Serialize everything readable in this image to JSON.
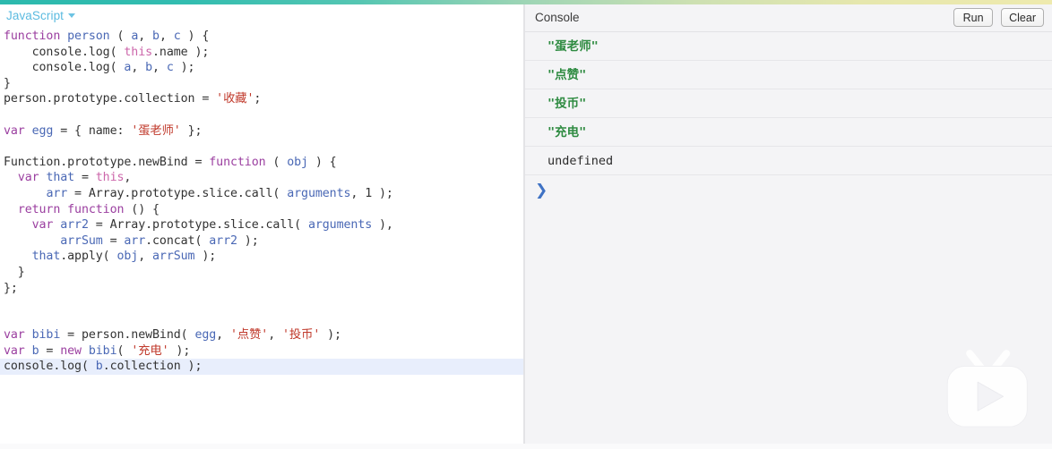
{
  "theme": {
    "gradient_start": "#2cb9ad",
    "gradient_end": "#eeeaae",
    "editor_bg": "#ffffff",
    "console_bg": "#f4f4f6",
    "active_line_bg": "#e8eefc",
    "string_color": "#c0392b",
    "keyword_color": "#9b3fa0",
    "identifier_color": "#4a68b5",
    "console_string_color": "#2e8b41",
    "prompt_color": "#3f72c4",
    "lang_label_color": "#5bbbe0"
  },
  "editor": {
    "language_label": "JavaScript",
    "dropdown_icon": "chevron-down-icon",
    "lines": [
      [
        {
          "t": "function",
          "c": "t-kw"
        },
        {
          "t": " ",
          "c": "t-plain"
        },
        {
          "t": "person",
          "c": "t-var"
        },
        {
          "t": " ( ",
          "c": "t-plain"
        },
        {
          "t": "a",
          "c": "t-var"
        },
        {
          "t": ", ",
          "c": "t-plain"
        },
        {
          "t": "b",
          "c": "t-var"
        },
        {
          "t": ", ",
          "c": "t-plain"
        },
        {
          "t": "c",
          "c": "t-var"
        },
        {
          "t": " ) {",
          "c": "t-plain"
        }
      ],
      [
        {
          "t": "    console.log( ",
          "c": "t-plain"
        },
        {
          "t": "this",
          "c": "t-this"
        },
        {
          "t": ".name );",
          "c": "t-plain"
        }
      ],
      [
        {
          "t": "    console.log( ",
          "c": "t-plain"
        },
        {
          "t": "a",
          "c": "t-var"
        },
        {
          "t": ", ",
          "c": "t-plain"
        },
        {
          "t": "b",
          "c": "t-var"
        },
        {
          "t": ", ",
          "c": "t-plain"
        },
        {
          "t": "c",
          "c": "t-var"
        },
        {
          "t": " );",
          "c": "t-plain"
        }
      ],
      [
        {
          "t": "}",
          "c": "t-plain"
        }
      ],
      [
        {
          "t": "person.prototype.collection = ",
          "c": "t-plain"
        },
        {
          "t": "'收藏'",
          "c": "t-str"
        },
        {
          "t": ";",
          "c": "t-plain"
        }
      ],
      [],
      [
        {
          "t": "var",
          "c": "t-kw"
        },
        {
          "t": " ",
          "c": "t-plain"
        },
        {
          "t": "egg",
          "c": "t-var"
        },
        {
          "t": " = { name: ",
          "c": "t-plain"
        },
        {
          "t": "'蛋老师'",
          "c": "t-str"
        },
        {
          "t": " };",
          "c": "t-plain"
        }
      ],
      [],
      [
        {
          "t": "Function.prototype.newBind = ",
          "c": "t-plain"
        },
        {
          "t": "function",
          "c": "t-kw"
        },
        {
          "t": " ( ",
          "c": "t-plain"
        },
        {
          "t": "obj",
          "c": "t-var"
        },
        {
          "t": " ) {",
          "c": "t-plain"
        }
      ],
      [
        {
          "t": "  ",
          "c": "t-plain"
        },
        {
          "t": "var",
          "c": "t-kw"
        },
        {
          "t": " ",
          "c": "t-plain"
        },
        {
          "t": "that",
          "c": "t-var"
        },
        {
          "t": " = ",
          "c": "t-plain"
        },
        {
          "t": "this",
          "c": "t-this"
        },
        {
          "t": ",",
          "c": "t-plain"
        }
      ],
      [
        {
          "t": "      ",
          "c": "t-plain"
        },
        {
          "t": "arr",
          "c": "t-var"
        },
        {
          "t": " = Array.prototype.slice.call( ",
          "c": "t-plain"
        },
        {
          "t": "arguments",
          "c": "t-var"
        },
        {
          "t": ", 1 );",
          "c": "t-plain"
        }
      ],
      [
        {
          "t": "  ",
          "c": "t-plain"
        },
        {
          "t": "return",
          "c": "t-kw"
        },
        {
          "t": " ",
          "c": "t-plain"
        },
        {
          "t": "function",
          "c": "t-kw"
        },
        {
          "t": " () {",
          "c": "t-plain"
        }
      ],
      [
        {
          "t": "    ",
          "c": "t-plain"
        },
        {
          "t": "var",
          "c": "t-kw"
        },
        {
          "t": " ",
          "c": "t-plain"
        },
        {
          "t": "arr2",
          "c": "t-var"
        },
        {
          "t": " = Array.prototype.slice.call( ",
          "c": "t-plain"
        },
        {
          "t": "arguments",
          "c": "t-var"
        },
        {
          "t": " ),",
          "c": "t-plain"
        }
      ],
      [
        {
          "t": "        ",
          "c": "t-plain"
        },
        {
          "t": "arrSum",
          "c": "t-var"
        },
        {
          "t": " = ",
          "c": "t-plain"
        },
        {
          "t": "arr",
          "c": "t-var"
        },
        {
          "t": ".concat( ",
          "c": "t-plain"
        },
        {
          "t": "arr2",
          "c": "t-var"
        },
        {
          "t": " );",
          "c": "t-plain"
        }
      ],
      [
        {
          "t": "    ",
          "c": "t-plain"
        },
        {
          "t": "that",
          "c": "t-var"
        },
        {
          "t": ".apply( ",
          "c": "t-plain"
        },
        {
          "t": "obj",
          "c": "t-var"
        },
        {
          "t": ", ",
          "c": "t-plain"
        },
        {
          "t": "arrSum",
          "c": "t-var"
        },
        {
          "t": " );",
          "c": "t-plain"
        }
      ],
      [
        {
          "t": "  }",
          "c": "t-plain"
        }
      ],
      [
        {
          "t": "};",
          "c": "t-plain"
        }
      ],
      [],
      [],
      [
        {
          "t": "var",
          "c": "t-kw"
        },
        {
          "t": " ",
          "c": "t-plain"
        },
        {
          "t": "bibi",
          "c": "t-var"
        },
        {
          "t": " = person.newBind( ",
          "c": "t-plain"
        },
        {
          "t": "egg",
          "c": "t-var"
        },
        {
          "t": ", ",
          "c": "t-plain"
        },
        {
          "t": "'点赞'",
          "c": "t-str"
        },
        {
          "t": ", ",
          "c": "t-plain"
        },
        {
          "t": "'投币'",
          "c": "t-str"
        },
        {
          "t": " );",
          "c": "t-plain"
        }
      ],
      [
        {
          "t": "var",
          "c": "t-kw"
        },
        {
          "t": " ",
          "c": "t-plain"
        },
        {
          "t": "b",
          "c": "t-var"
        },
        {
          "t": " = ",
          "c": "t-plain"
        },
        {
          "t": "new",
          "c": "t-kw"
        },
        {
          "t": " ",
          "c": "t-plain"
        },
        {
          "t": "bibi",
          "c": "t-var"
        },
        {
          "t": "( ",
          "c": "t-plain"
        },
        {
          "t": "'充电'",
          "c": "t-str"
        },
        {
          "t": " );",
          "c": "t-plain"
        }
      ],
      [
        {
          "t": "console.log( ",
          "c": "t-plain"
        },
        {
          "t": "b",
          "c": "t-var"
        },
        {
          "t": ".collection );",
          "c": "t-plain"
        }
      ]
    ],
    "active_line_index": 21
  },
  "console": {
    "title": "Console",
    "run_label": "Run",
    "clear_label": "Clear",
    "prompt_symbol": "❯",
    "output": [
      {
        "text": "\"蛋老师\"",
        "kind": "str"
      },
      {
        "text": "\"点赞\"",
        "kind": "str"
      },
      {
        "text": "\"投币\"",
        "kind": "str"
      },
      {
        "text": "\"充电\"",
        "kind": "str"
      },
      {
        "text": "undefined",
        "kind": "undef"
      }
    ]
  },
  "watermark": {
    "name": "bilibili-tv-logo"
  }
}
